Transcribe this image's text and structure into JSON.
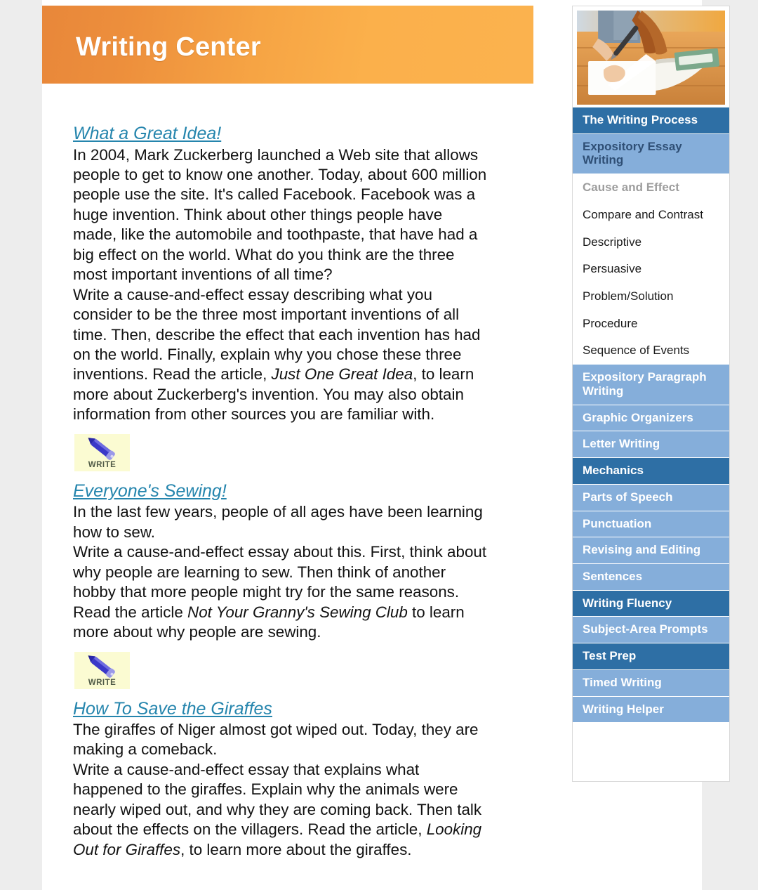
{
  "header": {
    "title": "Writing Center",
    "accent_left": "#e8873a",
    "accent_right": "#fbb04b"
  },
  "sidebar": {
    "photo_alt": "girl-writing-in-notebook",
    "nav": [
      {
        "label": "The Writing Process",
        "type": "section"
      },
      {
        "label": "Expository Essay Writing",
        "type": "parent-sel"
      },
      {
        "label": "Cause and Effect",
        "type": "sub",
        "current": true
      },
      {
        "label": "Compare and Contrast",
        "type": "sub"
      },
      {
        "label": "Descriptive",
        "type": "sub"
      },
      {
        "label": "Persuasive",
        "type": "sub"
      },
      {
        "label": "Problem/Solution",
        "type": "sub"
      },
      {
        "label": "Procedure",
        "type": "sub"
      },
      {
        "label": "Sequence of Events",
        "type": "sub"
      },
      {
        "label": "Expository Paragraph Writing",
        "type": "link"
      },
      {
        "label": "Graphic Organizers",
        "type": "link"
      },
      {
        "label": "Letter Writing",
        "type": "link"
      },
      {
        "label": "Mechanics",
        "type": "section"
      },
      {
        "label": "Parts of Speech",
        "type": "link"
      },
      {
        "label": "Punctuation",
        "type": "link"
      },
      {
        "label": "Revising and Editing",
        "type": "link"
      },
      {
        "label": "Sentences",
        "type": "link"
      },
      {
        "label": "Writing Fluency",
        "type": "section"
      },
      {
        "label": "Subject-Area Prompts",
        "type": "link"
      },
      {
        "label": "Test Prep",
        "type": "section"
      },
      {
        "label": "Timed Writing",
        "type": "link"
      },
      {
        "label": "Writing Helper",
        "type": "link"
      }
    ],
    "colors": {
      "section_bg": "#2e6fa5",
      "link_bg": "#85aeda",
      "current_text": "#9d9d9d"
    }
  },
  "entries": [
    {
      "title": "What a Great Idea!",
      "intro": "In 2004, Mark Zuckerberg launched a Web site that allows people to get to know one another. Today, about 600 million people use the site. It's called Facebook. Facebook was a huge invention. Think about other things people have made, like the automobile and toothpaste, that have had a big effect on the world. What do you think are the three most important inventions of all time?",
      "prompt_part1": "Write a cause-and-effect essay describing what you consider to be the three most important inventions of all time. Then, describe the effect that each invention has had on the world. Finally, explain why you chose these three inventions. Read the article, ",
      "prompt_italic": "Just One Great Idea",
      "prompt_part2": ", to learn more about Zuckerberg's invention. You may also obtain information from other sources you are familiar with.",
      "write_label": "WRITE"
    },
    {
      "title": "Everyone's Sewing!",
      "intro": "In the last few years, people of all ages have been learning how to sew.",
      "prompt_part1": "Write a cause-and-effect essay about this. First, think about why people are learning to sew. Then think of another hobby that more people might try for the same reasons. Read the article ",
      "prompt_italic": "Not Your Granny's Sewing Club",
      "prompt_part2": " to learn more about why people are sewing.",
      "write_label": "WRITE"
    },
    {
      "title": "How To Save the Giraffes",
      "intro": "The giraffes of Niger almost got wiped out. Today, they are making a comeback.",
      "prompt_part1": "Write a cause-and-effect essay that explains what happened to the giraffes. Explain why the animals were nearly wiped out, and why they are coming back. Then talk about the effects on the villagers. Read the article, ",
      "prompt_italic": "Looking Out for Giraffes",
      "prompt_part2": ", to learn more about the giraffes.",
      "write_label": "WRITE"
    }
  ],
  "icons": {
    "pencil": "pencil-icon"
  }
}
